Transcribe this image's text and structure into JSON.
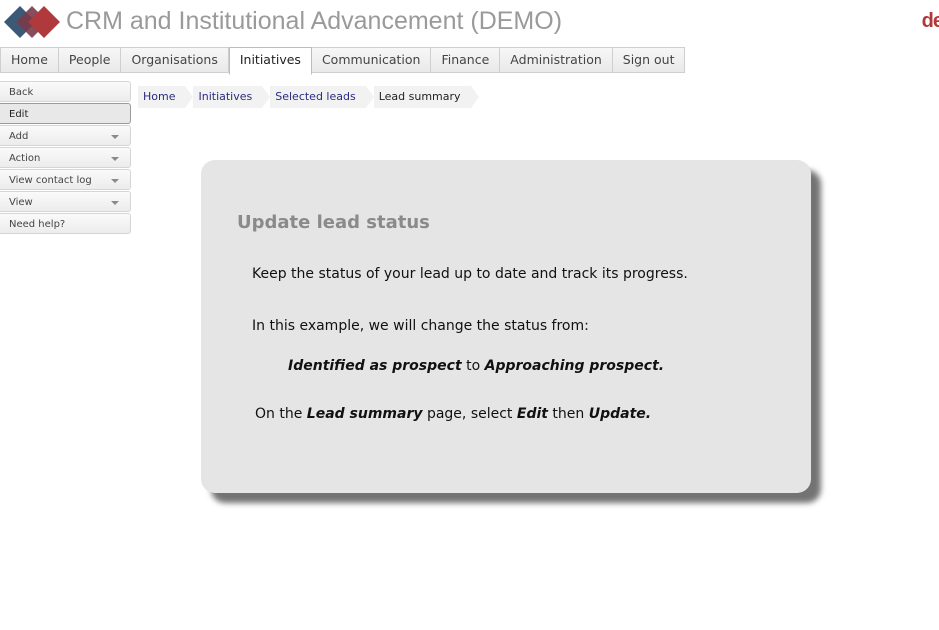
{
  "app": {
    "title": "CRM and Institutional Advancement (DEMO)",
    "brand_mark": "de"
  },
  "colors": {
    "accent_red": "#b0393b",
    "accent_blue": "#3b5a78",
    "card_bg": "#e5e5e5"
  },
  "topnav": {
    "tabs": [
      {
        "label": "Home"
      },
      {
        "label": "People"
      },
      {
        "label": "Organisations"
      },
      {
        "label": "Initiatives",
        "active": true
      },
      {
        "label": "Communication"
      },
      {
        "label": "Finance"
      },
      {
        "label": "Administration"
      },
      {
        "label": "Sign out"
      }
    ]
  },
  "sidebar": {
    "items": [
      {
        "label": "Back"
      },
      {
        "label": "Edit",
        "active": true
      },
      {
        "label": "Add",
        "dropdown": true
      },
      {
        "label": "Action",
        "dropdown": true
      },
      {
        "label": "View contact log",
        "dropdown": true
      },
      {
        "label": "View",
        "dropdown": true
      },
      {
        "label": "Need help?"
      }
    ]
  },
  "breadcrumb": [
    "Home",
    "Initiatives",
    "Selected leads",
    "Lead summary"
  ],
  "dialog": {
    "title": "Update lead status",
    "line1": "Keep the status of your lead up to date and track its progress.",
    "line2": "In this example, we will change the status from:",
    "from_status": "Identified as prospect",
    "to_word": "to",
    "to_status": "Approaching prospect.",
    "line4_prefix": "On the",
    "page_name": "Lead summary",
    "line4_mid": "page, select",
    "edit_word": "Edit",
    "then_word": "then",
    "update_word": "Update."
  }
}
